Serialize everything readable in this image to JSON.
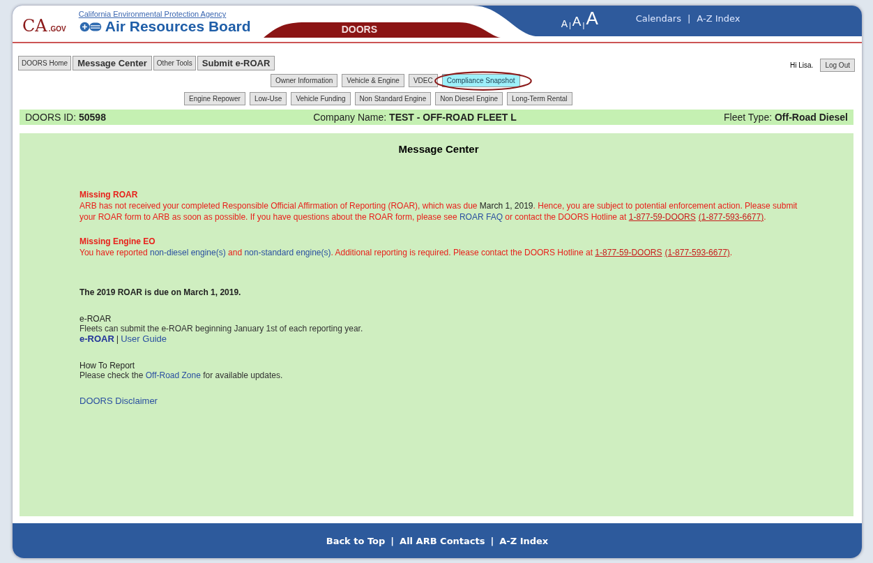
{
  "header": {
    "logo": {
      "mark": "CA",
      "suffix": ".GOV"
    },
    "agency": "California Environmental Protection Agency",
    "board": "Air Resources Board",
    "band": "DOORS",
    "font_sizes": [
      "A",
      "A",
      "A"
    ],
    "font_separator": "|",
    "links": [
      "Calendars",
      "A-Z Index"
    ],
    "link_separator": "|"
  },
  "main_tabs": [
    {
      "label": "DOORS Home",
      "bold": false
    },
    {
      "label": "Message Center",
      "bold": true
    },
    {
      "label": "Other Tools",
      "bold": false
    },
    {
      "label": "Submit e-ROAR",
      "bold": true
    }
  ],
  "user": {
    "greeting": "Hi Lisa.",
    "logout": "Log Out"
  },
  "sub_tabs": [
    [
      {
        "label": "Owner Information",
        "highlighted": false,
        "circled": false
      },
      {
        "label": "Vehicle & Engine",
        "highlighted": false,
        "circled": false
      },
      {
        "label": "VDEC",
        "highlighted": false,
        "circled": false
      },
      {
        "label": "Compliance Snapshot",
        "highlighted": true,
        "circled": true
      }
    ],
    [
      {
        "label": "Engine Repower",
        "highlighted": false,
        "circled": false
      },
      {
        "label": "Low-Use",
        "highlighted": false,
        "circled": false
      },
      {
        "label": "Vehicle Funding",
        "highlighted": false,
        "circled": false
      },
      {
        "label": "Non Standard Engine",
        "highlighted": false,
        "circled": false
      },
      {
        "label": "Non Diesel Engine",
        "highlighted": false,
        "circled": false
      },
      {
        "label": "Long-Term Rental",
        "highlighted": false,
        "circled": false
      }
    ]
  ],
  "info_bar": [
    {
      "label": "DOORS ID:",
      "value": "50598"
    },
    {
      "label": "Company Name:",
      "value": "TEST - OFF-ROAD FLEET L"
    },
    {
      "label": "Fleet Type:",
      "value": "Off-Road Diesel"
    }
  ],
  "panel": {
    "title": "Message Center",
    "alerts": [
      {
        "title": "Missing ROAR",
        "segments": [
          {
            "kind": "text",
            "text": "ARB has not received your completed Responsible Official Affirmation of Reporting (ROAR), which was due "
          },
          {
            "kind": "date",
            "text": "March 1, 2019"
          },
          {
            "kind": "text",
            "text": ". Hence, you are subject to potential enforcement action. Please submit your ROAR form to ARB as soon as possible. If you have questions about the ROAR form, please see "
          },
          {
            "kind": "link",
            "text": "ROAR FAQ"
          },
          {
            "kind": "text",
            "text": " or contact the DOORS Hotline at "
          },
          {
            "kind": "phone",
            "text": "1-877-59-DOORS"
          },
          {
            "kind": "phone",
            "text": "(1-877-593-6677)"
          },
          {
            "kind": "text",
            "text": "."
          }
        ]
      },
      {
        "title": "Missing Engine EO",
        "segments": [
          {
            "kind": "text",
            "text": "You have reported "
          },
          {
            "kind": "link",
            "text": "non-diesel engine(s)"
          },
          {
            "kind": "text",
            "text": " and "
          },
          {
            "kind": "link",
            "text": "non-standard engine(s)"
          },
          {
            "kind": "text",
            "text": ". Additional reporting is required. Please contact the DOORS Hotline at "
          },
          {
            "kind": "phone",
            "text": "1-877-59-DOORS"
          },
          {
            "kind": "phone",
            "text": "(1-877-593-6677)"
          },
          {
            "kind": "text",
            "text": "."
          }
        ]
      }
    ],
    "due_notice": "The 2019 ROAR is due on March 1, 2019.",
    "sections": [
      {
        "title": "e-ROAR",
        "body": [
          {
            "kind": "text",
            "text": "Fleets can submit the e-ROAR beginning January 1st of each reporting year."
          }
        ],
        "links": [
          {
            "text": "e-ROAR",
            "bold": true
          },
          {
            "text": "User Guide",
            "bold": false
          }
        ],
        "link_separator": "|"
      },
      {
        "title": "How To Report",
        "body": [
          {
            "kind": "text",
            "text": "Please check the "
          },
          {
            "kind": "link",
            "text": "Off-Road Zone"
          },
          {
            "kind": "text",
            "text": " for available updates."
          }
        ]
      }
    ],
    "disclaimer": "DOORS Disclaimer"
  },
  "footer": {
    "links": [
      "Back to Top",
      "All ARB Contacts",
      "A-Z Index"
    ],
    "separator": "|"
  }
}
